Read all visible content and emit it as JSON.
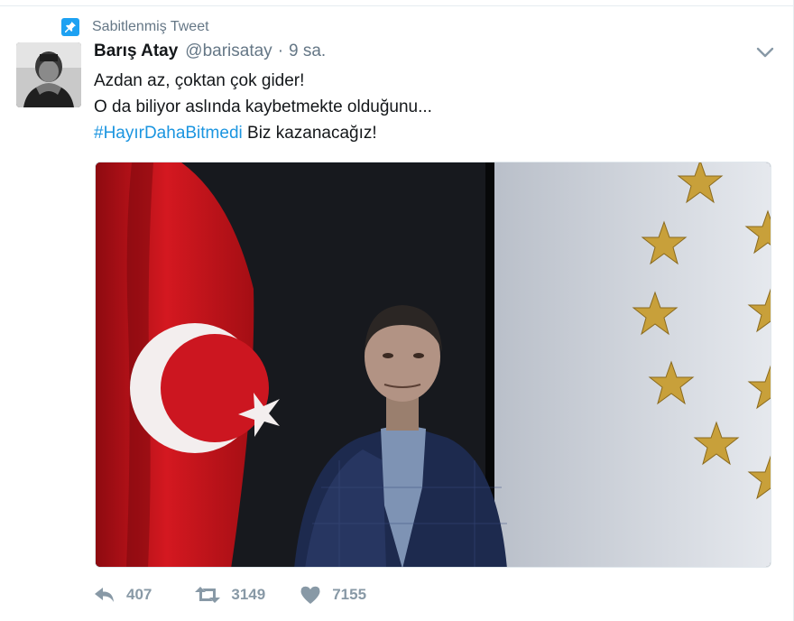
{
  "pinned": {
    "label": "Sabitlenmiş Tweet",
    "icon": "pin-icon"
  },
  "tweet": {
    "author_name": "Barış Atay",
    "author_handle": "@barisatay",
    "separator": "·",
    "time": "9 sa.",
    "lines": [
      "Azdan az, çoktan çok gider!",
      "O da biliyor aslında kaybetmekte olduğunu..."
    ],
    "hashtag": "#HayırDahaBitmedi",
    "after_hashtag": " Biz kazanacağız!"
  },
  "actions": {
    "reply": {
      "icon": "reply-icon",
      "count": "407"
    },
    "retweet": {
      "icon": "retweet-icon",
      "count": "3149"
    },
    "like": {
      "icon": "heart-icon",
      "count": "7155"
    }
  },
  "colors": {
    "accent": "#1da1f2",
    "link": "#1b95e0",
    "muted": "#8899a6",
    "flag_red": "#e30a17"
  }
}
